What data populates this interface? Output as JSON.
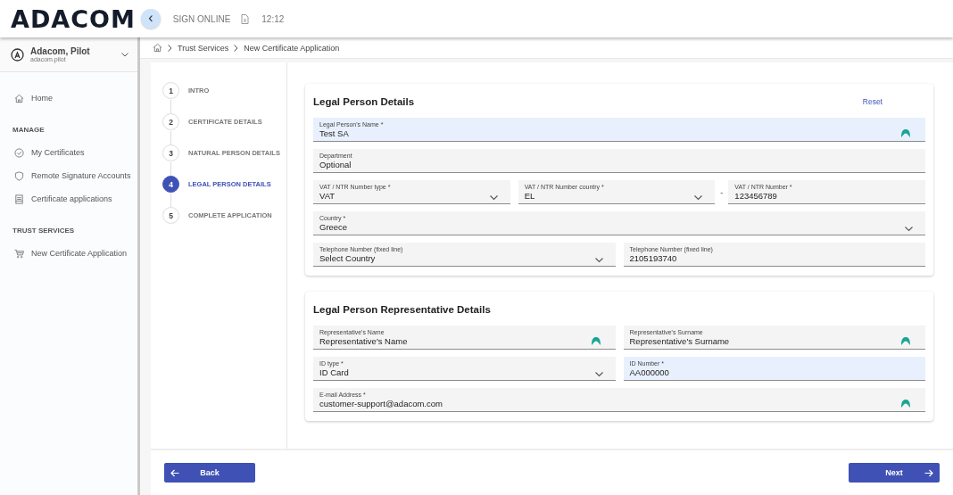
{
  "header": {
    "logo": "ADACOM",
    "collapse_icon": "‹",
    "app_name": "SIGN ONLINE",
    "time": "12:12"
  },
  "sidebar": {
    "user": {
      "name": "Adacom, Pilot",
      "login": "adacom.pilot"
    },
    "groups": [
      {
        "items": [
          {
            "label": "Home",
            "kind": "home",
            "selected": false
          }
        ]
      },
      {
        "heading": "MANAGE",
        "items": [
          {
            "label": "My Certificates",
            "kind": "check",
            "selected": false
          },
          {
            "label": "Remote Signature Accounts",
            "kind": "shield",
            "selected": false
          },
          {
            "label": "Certificate applications",
            "kind": "doc",
            "selected": false
          }
        ]
      },
      {
        "heading": "TRUST SERVICES",
        "items": [
          {
            "label": "New Certificate Application",
            "kind": "cart",
            "selected": false
          }
        ]
      }
    ]
  },
  "breadcrumb": [
    "Trust Services",
    "New Certificate Application"
  ],
  "steps": [
    {
      "number": "1",
      "label": "INTRO",
      "selected": false
    },
    {
      "number": "2",
      "label": "CERTIFICATE DETAILS",
      "selected": false
    },
    {
      "number": "3",
      "label": "NATURAL PERSON DETAILS",
      "selected": false
    },
    {
      "number": "4",
      "label": "LEGAL PERSON DETAILS",
      "selected": true
    },
    {
      "number": "5",
      "label": "COMPLETE APPLICATION",
      "selected": false
    }
  ],
  "sections": [
    {
      "title": "Legal Person Details",
      "action": "Reset",
      "rows": [
        [
          {
            "kind": "text",
            "label": "Legal Person's Name *",
            "value": "Test SA",
            "autofilled": true,
            "badge": true
          }
        ],
        [
          {
            "kind": "text",
            "label": "Department",
            "value": "Optional",
            "autofilled": false,
            "badge": false
          }
        ],
        [
          {
            "kind": "select",
            "label": "VAT / NTR Number type *",
            "value": "VAT",
            "autofilled": false,
            "badge": false
          },
          {
            "kind": "select",
            "label": "VAT / NTR Number country *",
            "value": "EL",
            "autofilled": false,
            "badge": false
          },
          {
            "kind": "separator",
            "text": "-"
          },
          {
            "kind": "text",
            "label": "VAT / NTR Number *",
            "value": "123456789",
            "autofilled": false,
            "badge": false
          }
        ],
        [
          {
            "kind": "select",
            "label": "Country *",
            "value": "Greece",
            "autofilled": false,
            "badge": false
          }
        ],
        [
          {
            "kind": "select",
            "label": "Telephone Number (fixed line)",
            "value": "Select Country",
            "autofilled": false,
            "badge": false
          },
          {
            "kind": "text",
            "label": "Telephone Number (fixed line)",
            "value": "2105193740",
            "autofilled": false,
            "badge": false
          }
        ]
      ]
    },
    {
      "title": "Legal Person Representative Details",
      "rows": [
        [
          {
            "kind": "text",
            "label": "Representative's Name",
            "value": "Representative's Name",
            "autofilled": false,
            "badge": true
          },
          {
            "kind": "text",
            "label": "Representative's Surname",
            "value": "Representative's Surname",
            "autofilled": false,
            "badge": true
          }
        ],
        [
          {
            "kind": "select",
            "label": "ID type *",
            "value": "ID Card",
            "autofilled": false,
            "badge": false
          },
          {
            "kind": "text",
            "label": "ID Number *",
            "value": "AA000000",
            "autofilled": true,
            "badge": false
          }
        ],
        [
          {
            "kind": "text",
            "label": "E-mail Address *",
            "value": "customer-support@adacom.com",
            "autofilled": false,
            "badge": true
          }
        ]
      ]
    }
  ],
  "buttons": {
    "back": "Back",
    "next": "Next"
  }
}
